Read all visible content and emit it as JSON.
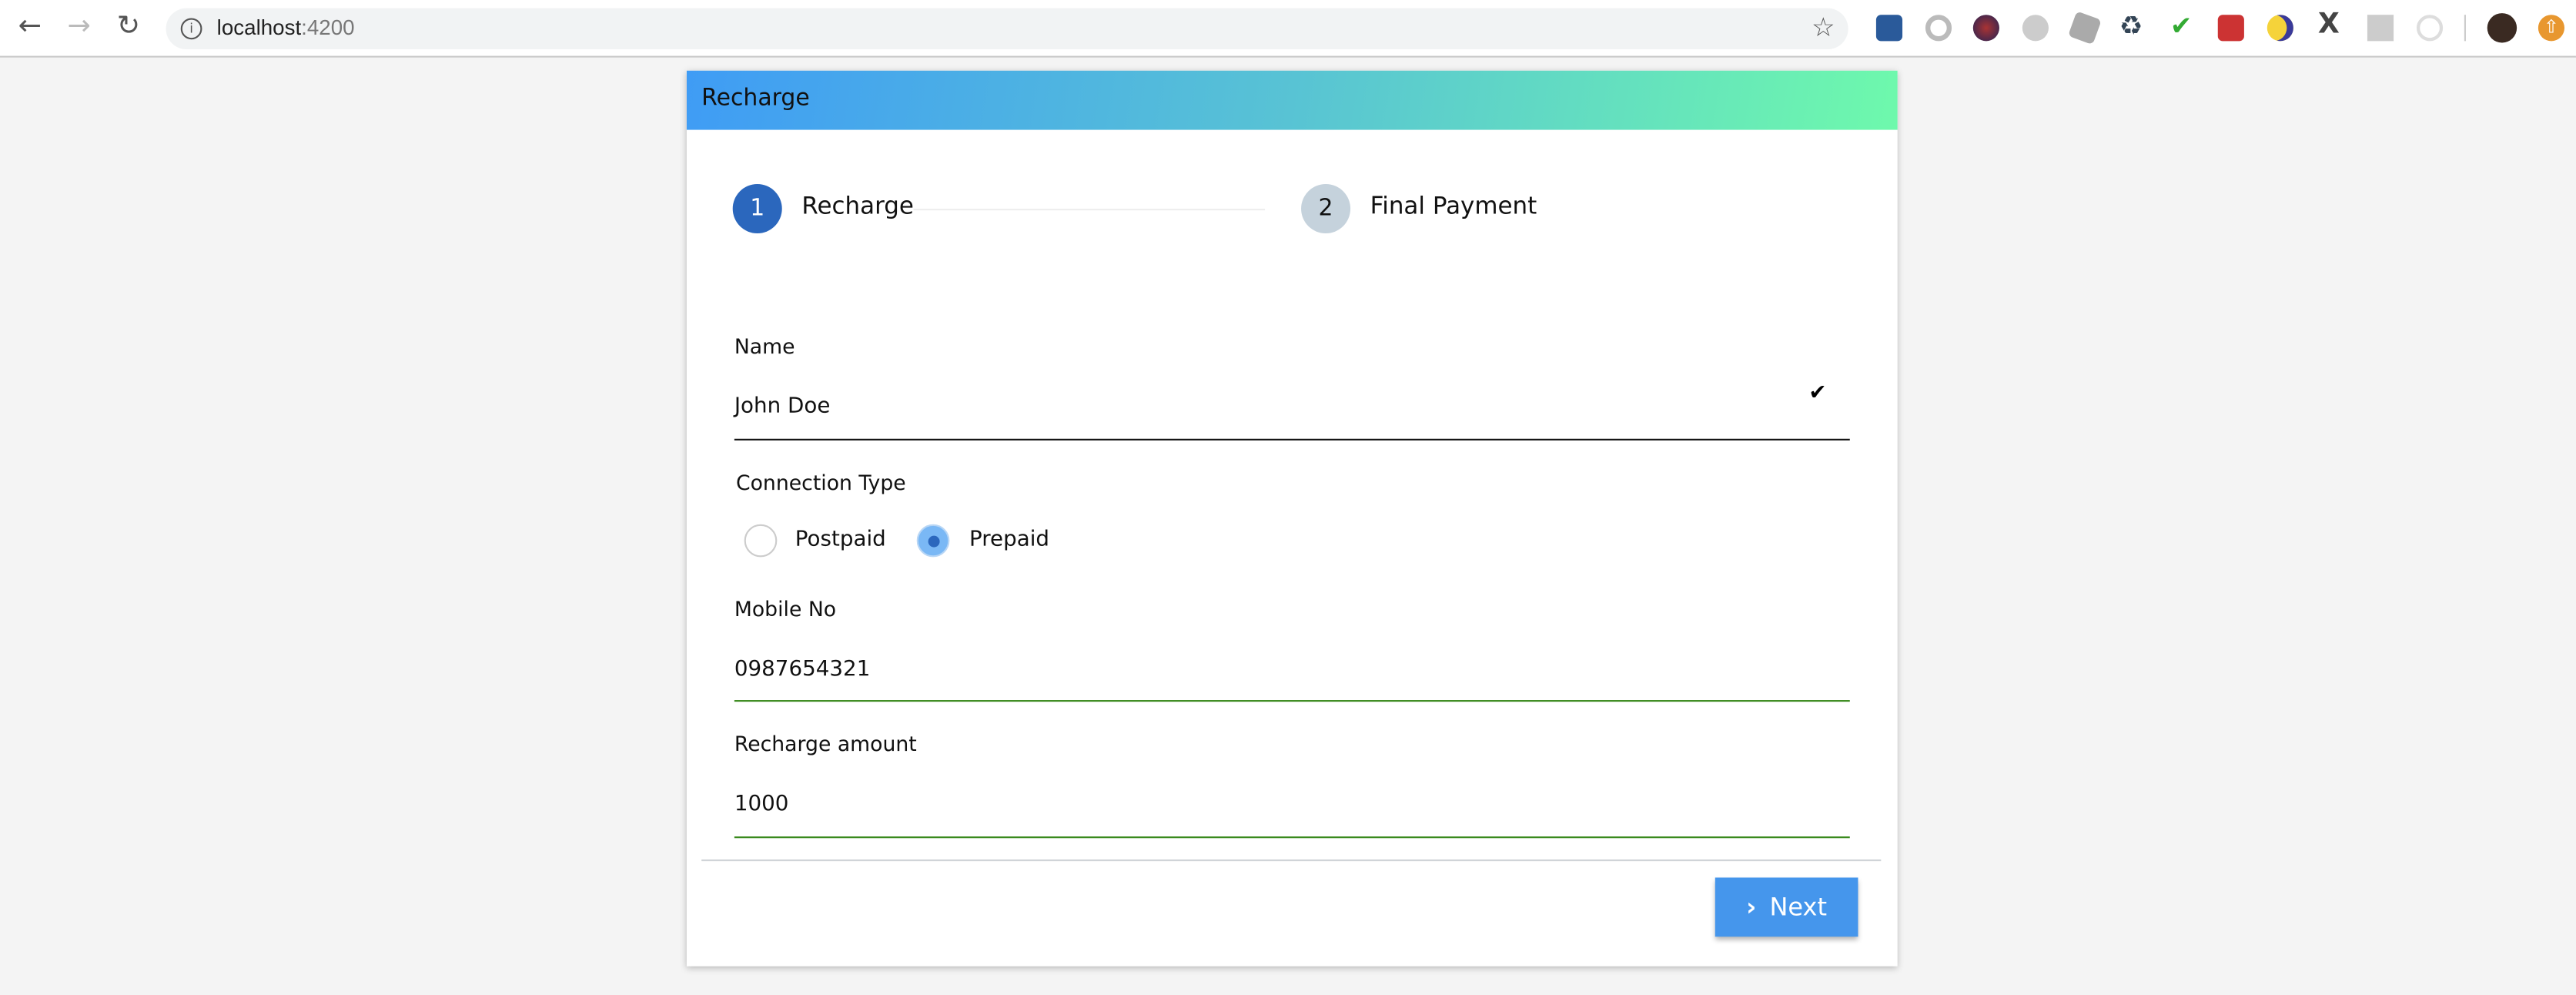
{
  "browser": {
    "url_host": "localhost",
    "url_port": ":4200",
    "extension_icons": [
      "cookie-inspector-icon",
      "ring-icon",
      "balls-icon",
      "u-icon",
      "envelope-gray-icon",
      "recycle-icon",
      "abc-check-icon",
      "mail-red-icon",
      "moon-icon",
      "x-icon",
      "g-icon",
      "target-icon"
    ]
  },
  "card": {
    "title": "Recharge"
  },
  "stepper": {
    "steps": [
      {
        "number": "1",
        "label": "Recharge",
        "active": true
      },
      {
        "number": "2",
        "label": "Final Payment",
        "active": false
      }
    ]
  },
  "form": {
    "name": {
      "label": "Name",
      "value": "John Doe"
    },
    "connection": {
      "label": "Connection Type",
      "options": [
        "Postpaid",
        "Prepaid"
      ],
      "selected": "Prepaid"
    },
    "mobile": {
      "label": "Mobile No",
      "value": "0987654321"
    },
    "amount": {
      "label": "Recharge amount",
      "value": "1000"
    }
  },
  "actions": {
    "next_label": "Next"
  },
  "colors": {
    "header_start": "#3f9cf5",
    "header_end": "#6ef9ac",
    "step_active": "#2b67bd",
    "step_inactive": "#c5d2dc",
    "valid": "#3a8a1e",
    "button": "#4596ec"
  }
}
